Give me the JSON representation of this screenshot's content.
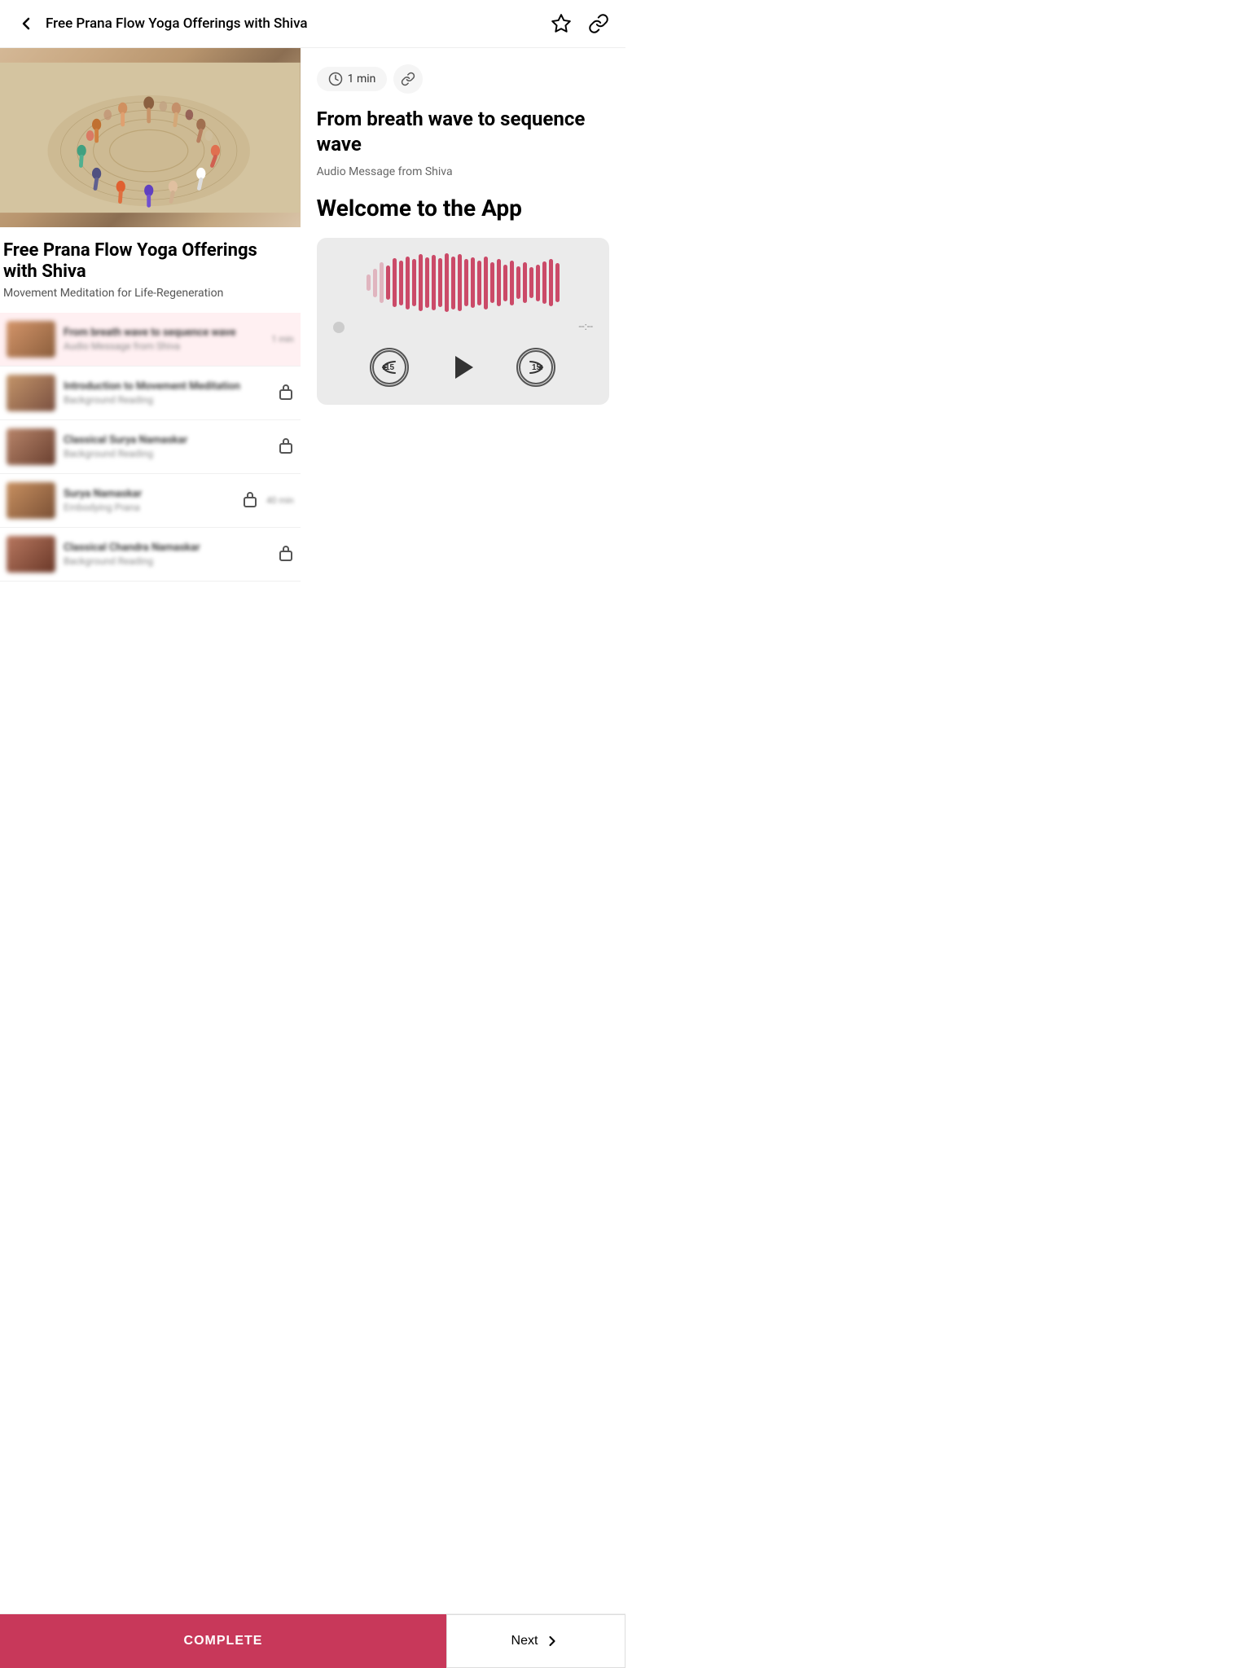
{
  "header": {
    "back_label": "←",
    "title": "Free Prana Flow Yoga Offerings with Shiva",
    "bookmark_icon": "☆",
    "link_icon": "🔗"
  },
  "course": {
    "title": "Free Prana Flow Yoga Offerings with Shiva",
    "subtitle": "Movement Meditation for Life-Regeneration"
  },
  "lesson": {
    "title": "From breath wave to sequence wave",
    "author": "Audio Message from Shiva",
    "duration": "1 min",
    "welcome_heading": "Welcome to the App"
  },
  "audio": {
    "current_time": "",
    "total_time": "--:--",
    "skip_back_label": "15",
    "skip_forward_label": "15"
  },
  "lessons": [
    {
      "id": 1,
      "name": "From breath wave to sequence wave",
      "type": "Audio Message from Shiva",
      "duration": "1 min",
      "locked": false,
      "active": true,
      "thumb_class": "thumb-1"
    },
    {
      "id": 2,
      "name": "Introduction to Movement Meditation",
      "type": "Background Reading",
      "duration": "",
      "locked": true,
      "active": false,
      "thumb_class": "thumb-2"
    },
    {
      "id": 3,
      "name": "Classical Surya Namaskar",
      "type": "Background Reading",
      "duration": "",
      "locked": true,
      "active": false,
      "thumb_class": "thumb-3"
    },
    {
      "id": 4,
      "name": "Surya Namaskar",
      "type": "Embodying Prana",
      "duration": "40 min",
      "locked": true,
      "active": false,
      "thumb_class": "thumb-4"
    },
    {
      "id": 5,
      "name": "Classical Chandra Namaskar",
      "type": "Background Reading",
      "duration": "",
      "locked": true,
      "active": false,
      "thumb_class": "thumb-5"
    }
  ],
  "buttons": {
    "complete": "COMPLETE",
    "next": "Next"
  }
}
